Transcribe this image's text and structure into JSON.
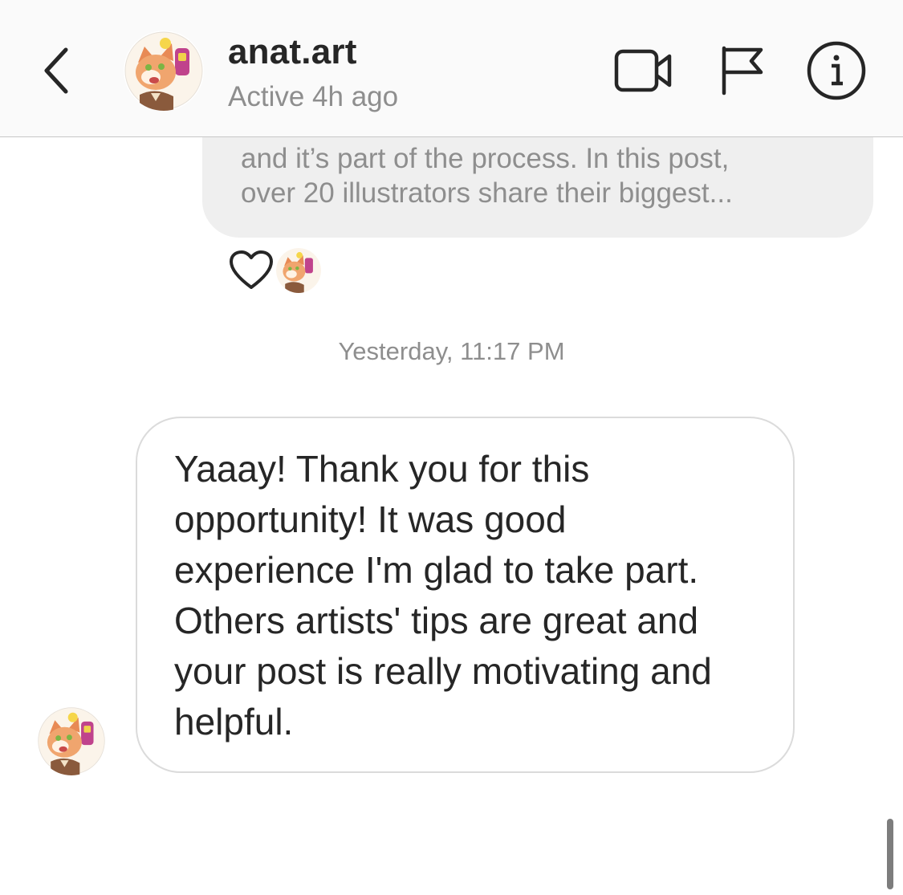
{
  "header": {
    "username": "anat.art",
    "status": "Active 4h ago",
    "icons": [
      "back-chevron-icon",
      "video-call-icon",
      "flag-icon",
      "info-icon"
    ]
  },
  "thread": {
    "previous_message": {
      "lines": [
        "and it’s part of the process. In this post,",
        "over 20 illustrators share their biggest..."
      ],
      "liked": true
    },
    "timestamp": "Yesterday, 11:17 PM",
    "message": {
      "lines": [
        "Yaaay! Thank you for this",
        "opportunity! It was good",
        "experience I'm glad to take part.",
        "Others artists' tips are great and",
        "your post is really motivating and",
        "helpful."
      ]
    }
  },
  "colors": {
    "header_bg": "#fafafa",
    "bubble_gray": "#efefef",
    "muted_text": "#8e8e8e",
    "primary_text": "#262626",
    "bubble_border": "#dbdbdb"
  }
}
